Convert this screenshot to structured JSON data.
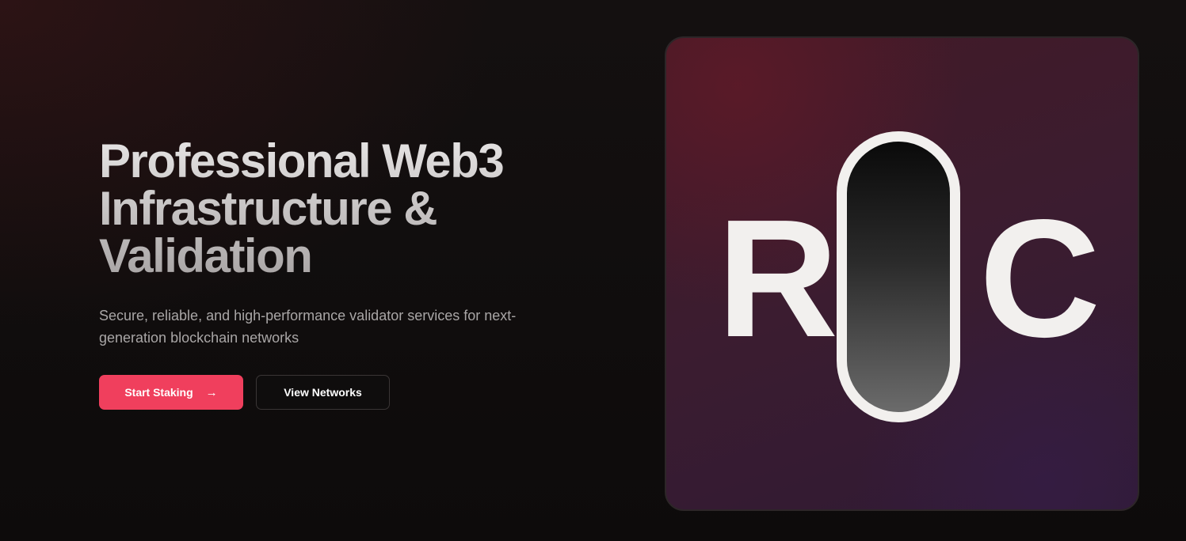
{
  "hero": {
    "headline_lines": [
      "Professional Web3",
      "Infrastructure &",
      "Validation"
    ],
    "subtitle": "Secure, reliable, and high-performance validator services for next-generation blockchain networks",
    "primary_button": {
      "label": "Start Staking",
      "icon": "arrow-right-icon"
    },
    "secondary_button": {
      "label": "View Networks"
    }
  },
  "logo": {
    "letters": [
      "R",
      "C"
    ]
  },
  "colors": {
    "accent": "#f03f5d",
    "background": "#0d0b0b",
    "card_gradient_start": "#421a26",
    "card_gradient_end": "#2f1a34",
    "logo_letter": "#f2f0ee"
  }
}
